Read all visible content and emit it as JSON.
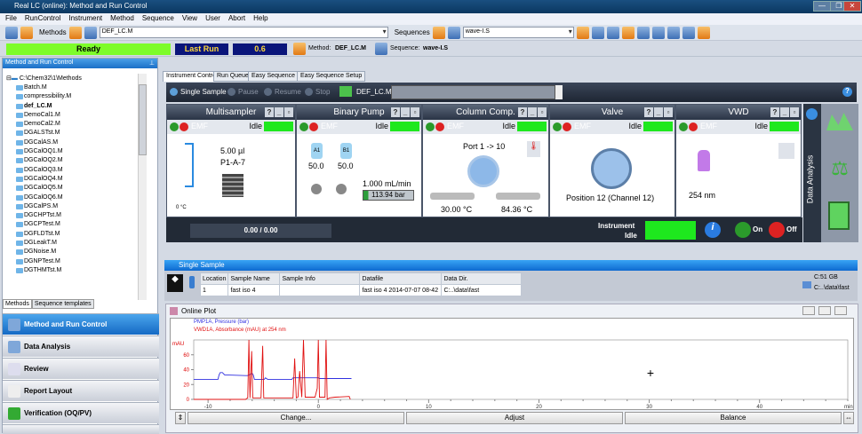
{
  "window": {
    "title": "Real LC (online): Method and Run Control",
    "controls": [
      "—",
      "❐",
      "✕"
    ]
  },
  "menu": [
    "File",
    "RunControl",
    "Instrument",
    "Method",
    "Sequence",
    "View",
    "User",
    "Abort",
    "Help"
  ],
  "toolbar": {
    "methods_label": "Methods",
    "method_value": "DEF_LC.M",
    "sequences_label": "Sequences",
    "sequence_value": "wave-I.S"
  },
  "status": {
    "state": "Ready",
    "state_color": "#7dfc2a",
    "last_run_label": "Last Run",
    "last_run_value": "0.6",
    "method_label": "Method:",
    "method_value": "DEF_LC.M",
    "sequence_label": "Sequence:",
    "sequence_value": "wave-I.S"
  },
  "left": {
    "title": "Method and Run Control",
    "root": "C:\\Chem32\\1\\Methods",
    "items": [
      "Batch.M",
      "compressibility.M",
      "def_LC.M",
      "DemoCal1.M",
      "DemoCal2.M",
      "DGALSTst.M",
      "DGCalAS.M",
      "DGCalOQ1.M",
      "DGCalOQ2.M",
      "DGCalOQ3.M",
      "DGCalOQ4.M",
      "DGCalOQ5.M",
      "DGCalOQ6.M",
      "DGCalPS.M",
      "DGCHPTst.M",
      "DGCPTest.M",
      "DGFLDTst.M",
      "DGLeakT.M",
      "DGNoise.M",
      "DGNPTest.M",
      "DGTHMTst.M"
    ],
    "tabs": [
      "Methods",
      "Sequence templates"
    ],
    "nav": [
      "Method and Run Control",
      "Data Analysis",
      "Review",
      "Report Layout",
      "Verification (OQ/PV)"
    ]
  },
  "tabs": [
    "Instrument Control",
    "Run Queue",
    "Easy Sequence",
    "Easy Sequence Setup"
  ],
  "control": {
    "single_sample": "Single Sample",
    "pause": "Pause",
    "resume": "Resume",
    "stop": "Stop",
    "method": "DEF_LC.M"
  },
  "modules": {
    "multisampler": {
      "title": "Multisampler",
      "status": "Idle",
      "emf": "EMF",
      "volume": "5.00 µl",
      "position": "P1-A-7",
      "temp": "0 °C"
    },
    "pump": {
      "title": "Binary Pump",
      "status": "Idle",
      "emf": "EMF",
      "a": "A1",
      "b": "B1",
      "a_level": "50.0",
      "b_level": "50.0",
      "flow": "1.000 mL/min",
      "pressure": "113.94 bar"
    },
    "column": {
      "title": "Column Comp.",
      "status": "Idle",
      "emf": "EMF",
      "port": "Port 1 -> 10",
      "temp_left": "30.00 °C",
      "temp_right": "84.36 °C"
    },
    "valve": {
      "title": "Valve",
      "status": "Idle",
      "emf": "EMF",
      "position": "Position 12 (Channel 12)"
    },
    "vwd": {
      "title": "VWD",
      "status": "Idle",
      "emf": "EMF",
      "wavelength": "254 nm"
    }
  },
  "bottom": {
    "progress": "0.00 / 0.00",
    "instrument": "Instrument",
    "idle": "Idle",
    "on": "On",
    "off": "Off"
  },
  "data_analysis_label": "Data Analysis",
  "single_sample": {
    "title": "Single Sample",
    "columns": [
      "Location",
      "Sample Name",
      "Sample Info",
      "Datafile",
      "Data Dir."
    ],
    "row": [
      "1",
      "fast iso 4",
      "",
      "fast iso 4 2014-07-07 08-42",
      "C:..\\data\\fast"
    ],
    "disk": "C:51 GB",
    "dir": "C:..\\data\\fast"
  },
  "plot": {
    "title": "Online Plot",
    "buttons": [
      "Change...",
      "Adjust",
      "Balance"
    ]
  },
  "chart_data": {
    "type": "line",
    "ylabel": "mAU",
    "xlabel": "min",
    "xlim": [
      -11.3,
      48
    ],
    "ylim": [
      0,
      80
    ],
    "xticks": [
      -10,
      0,
      10,
      20,
      30,
      40
    ],
    "yticks": [
      0,
      20,
      40,
      60
    ],
    "series": [
      {
        "name": "PMP1A, Pressure (bar)",
        "color": "#3030e0",
        "x": [
          -11.3,
          -9.1,
          -9,
          -8.9,
          -8.7,
          -8.5,
          -6.6,
          -6.4,
          -6,
          -5.9,
          -5.8,
          -4.9,
          -4.8,
          -4.6,
          -2.4,
          -2.3,
          0,
          0.1,
          3
        ],
        "y": [
          27,
          27,
          33,
          36,
          36,
          33,
          32,
          32,
          35,
          33,
          27,
          27,
          29,
          27,
          27,
          29,
          29,
          28,
          28
        ]
      },
      {
        "name": "VWD1A, Absorbance (mAU) at 254 nm",
        "color": "#e01010",
        "x": [
          -11.3,
          -9.3,
          -6.6,
          -6.4,
          -6.3,
          -6.2,
          -6.05,
          -5.95,
          -5.85,
          -5.2,
          -5.05,
          -4.95,
          -4.8,
          -2.3,
          -2.15,
          -2.0,
          -1.85,
          -1.7,
          -1.5,
          -1.35,
          -1.2,
          -1.05,
          -0.9,
          -0.3,
          -0.1,
          0,
          0.1,
          0.2,
          0.6,
          0.7,
          0.8,
          1.0,
          1.5,
          2.8,
          2.9
        ],
        "y": [
          0,
          0,
          0,
          2,
          80,
          2,
          65,
          2,
          2,
          2,
          72,
          2,
          2,
          2,
          55,
          2,
          3,
          38,
          3,
          80,
          3,
          3,
          3,
          3,
          15,
          80,
          3,
          3,
          3,
          80,
          0,
          2,
          3,
          4,
          0
        ]
      }
    ]
  }
}
